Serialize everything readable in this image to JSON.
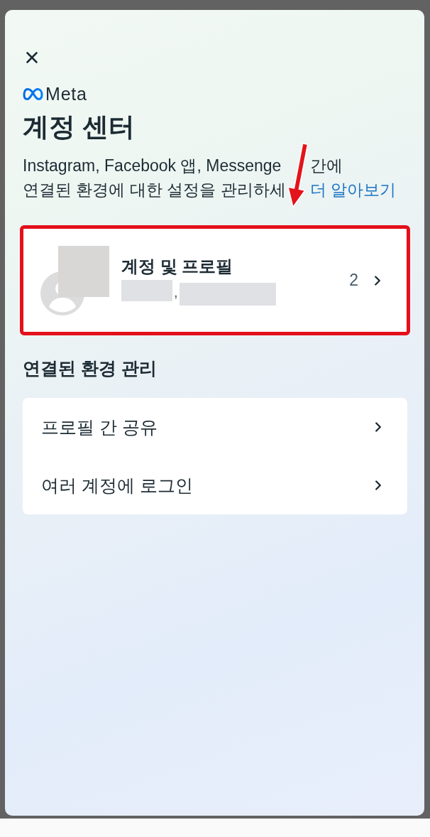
{
  "brand": {
    "name": "Meta"
  },
  "title": "계정 센터",
  "description": [
    [
      {
        "kind": "text",
        "text": "Instagram, Facebook 앱, Messenge"
      },
      {
        "kind": "text",
        "text": "간에"
      }
    ],
    [
      {
        "kind": "text",
        "text": "연결된 환경에 대한 설정을 관리하세"
      },
      {
        "kind": "link",
        "text": "더 알아보기"
      }
    ]
  ],
  "account_card": {
    "label": "계정 및 프로필",
    "separator": ",",
    "count": "2",
    "highlighted": true
  },
  "section": {
    "title": "연결된 환경 관리",
    "items": [
      {
        "label": "프로필 간 공유"
      },
      {
        "label": "여러 계정에 로그인"
      }
    ]
  }
}
